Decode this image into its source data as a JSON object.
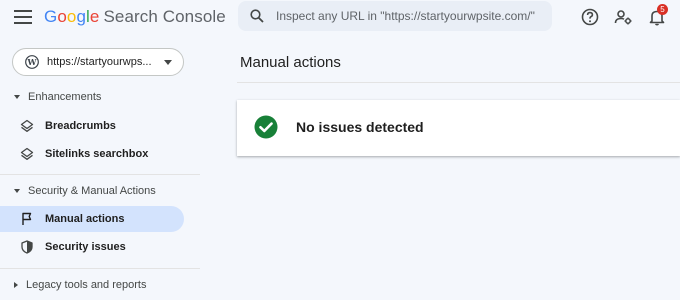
{
  "header": {
    "logo_letters": [
      "G",
      "o",
      "o",
      "g",
      "l",
      "e"
    ],
    "product": "Search Console",
    "search_placeholder": "Inspect any URL in \"https://startyourwpsite.com/\"",
    "notification_count": "5"
  },
  "sidebar": {
    "property": "https://startyourwps...",
    "sections": [
      {
        "label": "Enhancements",
        "items": [
          {
            "label": "Breadcrumbs",
            "icon": "diamond-layers-icon"
          },
          {
            "label": "Sitelinks searchbox",
            "icon": "diamond-layers-icon"
          }
        ]
      },
      {
        "label": "Security & Manual Actions",
        "items": [
          {
            "label": "Manual actions",
            "icon": "flag-icon",
            "active": true
          },
          {
            "label": "Security issues",
            "icon": "shield-icon"
          }
        ]
      },
      {
        "label": "Legacy tools and reports",
        "collapsed": true
      }
    ]
  },
  "main": {
    "title": "Manual actions",
    "status": "No issues detected"
  },
  "colors": {
    "accent": "#d3e3fd",
    "success": "#188038",
    "badge": "#d93025"
  }
}
